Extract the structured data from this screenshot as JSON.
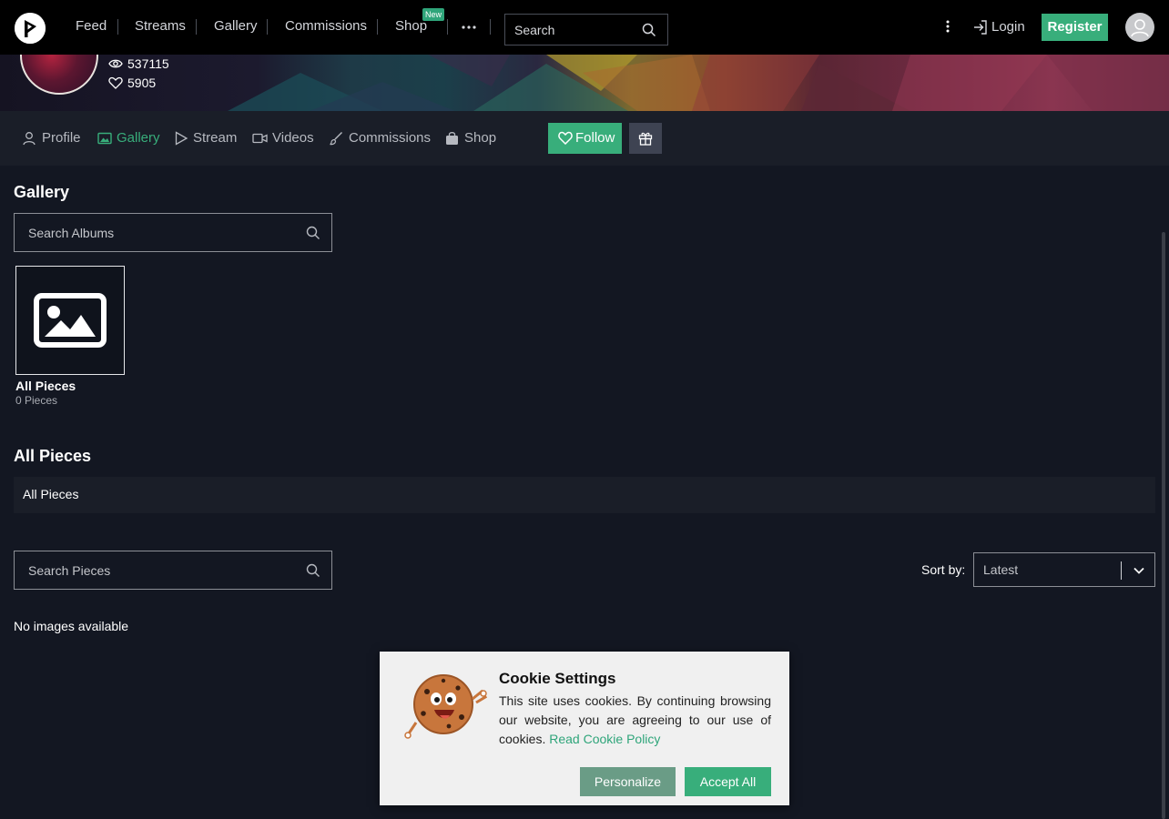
{
  "topnav": {
    "items": [
      {
        "label": "Feed"
      },
      {
        "label": "Streams"
      },
      {
        "label": "Gallery"
      },
      {
        "label": "Commissions"
      },
      {
        "label": "Shop"
      }
    ],
    "new_badge": "New",
    "search_placeholder": "Search",
    "login_label": "Login",
    "register_label": "Register"
  },
  "profile": {
    "views": "537115",
    "likes": "5905"
  },
  "subnav": {
    "items": [
      {
        "label": "Profile",
        "icon": "user-icon"
      },
      {
        "label": "Gallery",
        "icon": "image-icon",
        "active": true
      },
      {
        "label": "Stream",
        "icon": "play-icon"
      },
      {
        "label": "Videos",
        "icon": "video-icon"
      },
      {
        "label": "Commissions",
        "icon": "brush-icon"
      },
      {
        "label": "Shop",
        "icon": "bag-icon"
      }
    ],
    "follow_label": "Follow"
  },
  "gallery": {
    "title": "Gallery",
    "search_placeholder": "Search Albums",
    "albums": [
      {
        "title": "All Pieces",
        "count": "0 Pieces"
      }
    ]
  },
  "pieces": {
    "title": "All Pieces",
    "breadcrumb": "All Pieces",
    "search_placeholder": "Search Pieces",
    "sort_label": "Sort by:",
    "sort_value": "Latest",
    "empty_message": "No images available"
  },
  "cookie": {
    "title": "Cookie Settings",
    "text": "This site uses cookies. By continuing browsing our website, you are agreeing to our use of cookies.",
    "link": "Read Cookie Policy",
    "personalize_label": "Personalize",
    "accept_label": "Accept All"
  },
  "colors": {
    "accent": "#38ae7b",
    "background": "#131722",
    "panel": "#1a1e28"
  }
}
